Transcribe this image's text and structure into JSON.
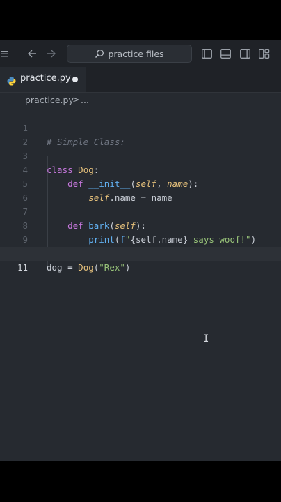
{
  "titlebar": {
    "search_placeholder": "practice files",
    "icons": [
      "menu-icon",
      "arrow-left-icon",
      "arrow-right-icon",
      "search-icon",
      "toggle-primary-sidebar-icon",
      "toggle-panel-icon",
      "toggle-secondary-sidebar-icon",
      "customize-layout-icon"
    ]
  },
  "tab": {
    "label": "practice.py",
    "modified": true
  },
  "breadcrumb": {
    "file": "practice.py",
    "separator": ">",
    "more": "..."
  },
  "editor": {
    "active_line": 11,
    "lines": [
      {
        "n": "1",
        "text": "# Simple Class:"
      },
      {
        "n": "2",
        "text": ""
      },
      {
        "n": "3",
        "text": "class Dog:"
      },
      {
        "n": "4",
        "text": "    def __init__(self, name):"
      },
      {
        "n": "5",
        "text": "        self.name = name"
      },
      {
        "n": "6",
        "text": ""
      },
      {
        "n": "7",
        "text": "    def bark(self):"
      },
      {
        "n": "8",
        "text": "        print(f\"{self.name} says woof!\")"
      },
      {
        "n": "9",
        "text": ""
      },
      {
        "n": "10",
        "text": "dog = Dog(\"Rex\")"
      },
      {
        "n": "11",
        "text": ""
      }
    ]
  },
  "colors": {
    "background": "#262a30",
    "keyword": "#c678dd",
    "class_name": "#e5c07b",
    "function": "#61afef",
    "string": "#98c379",
    "comment": "#717783"
  }
}
